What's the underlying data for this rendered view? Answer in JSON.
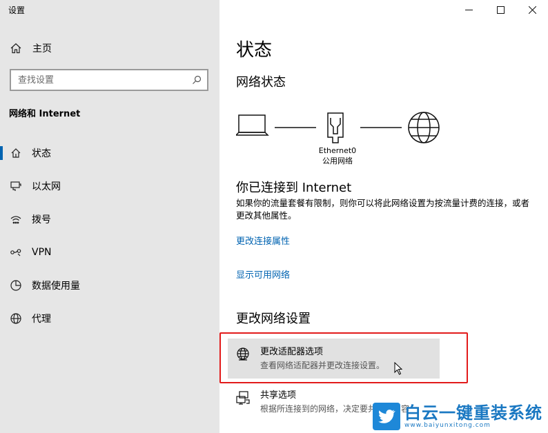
{
  "window": {
    "title": "设置"
  },
  "sidebar": {
    "home_label": "主页",
    "search_placeholder": "查找设置",
    "section_heading": "网络和 Internet",
    "items": [
      {
        "label": "状态",
        "icon": "home-status-icon",
        "selected": true
      },
      {
        "label": "以太网",
        "icon": "ethernet-icon"
      },
      {
        "label": "拨号",
        "icon": "dialup-icon"
      },
      {
        "label": "VPN",
        "icon": "vpn-icon"
      },
      {
        "label": "数据使用量",
        "icon": "data-usage-icon"
      },
      {
        "label": "代理",
        "icon": "proxy-globe-icon"
      }
    ]
  },
  "main": {
    "title": "状态",
    "network_status_heading": "网络状态",
    "diagram": {
      "adapter_name": "Ethernet0",
      "network_type": "公用网络"
    },
    "connected_heading": "你已连接到 Internet",
    "description": "如果你的流量套餐有限制，则你可以将此网络设置为按流量计费的连接，或者更改其他属性。",
    "links": {
      "change_properties": "更改连接属性",
      "show_networks": "显示可用网络"
    },
    "change_settings_heading": "更改网络设置",
    "options": [
      {
        "title": "更改适配器选项",
        "subtitle": "查看网络适配器并更改连接设置。",
        "icon": "adapter-globe-icon",
        "highlighted": true
      },
      {
        "title": "共享选项",
        "subtitle": "根据所连接到的网络，决定要共享的内容",
        "icon": "sharing-icon"
      }
    ]
  },
  "watermark": {
    "title": "白云一键重装系统",
    "url": "www.baiyunxitong.com"
  },
  "colors": {
    "accent": "#0063b1",
    "highlight_border": "#e21a1a",
    "sidebar_bg": "#e6e6e6"
  }
}
